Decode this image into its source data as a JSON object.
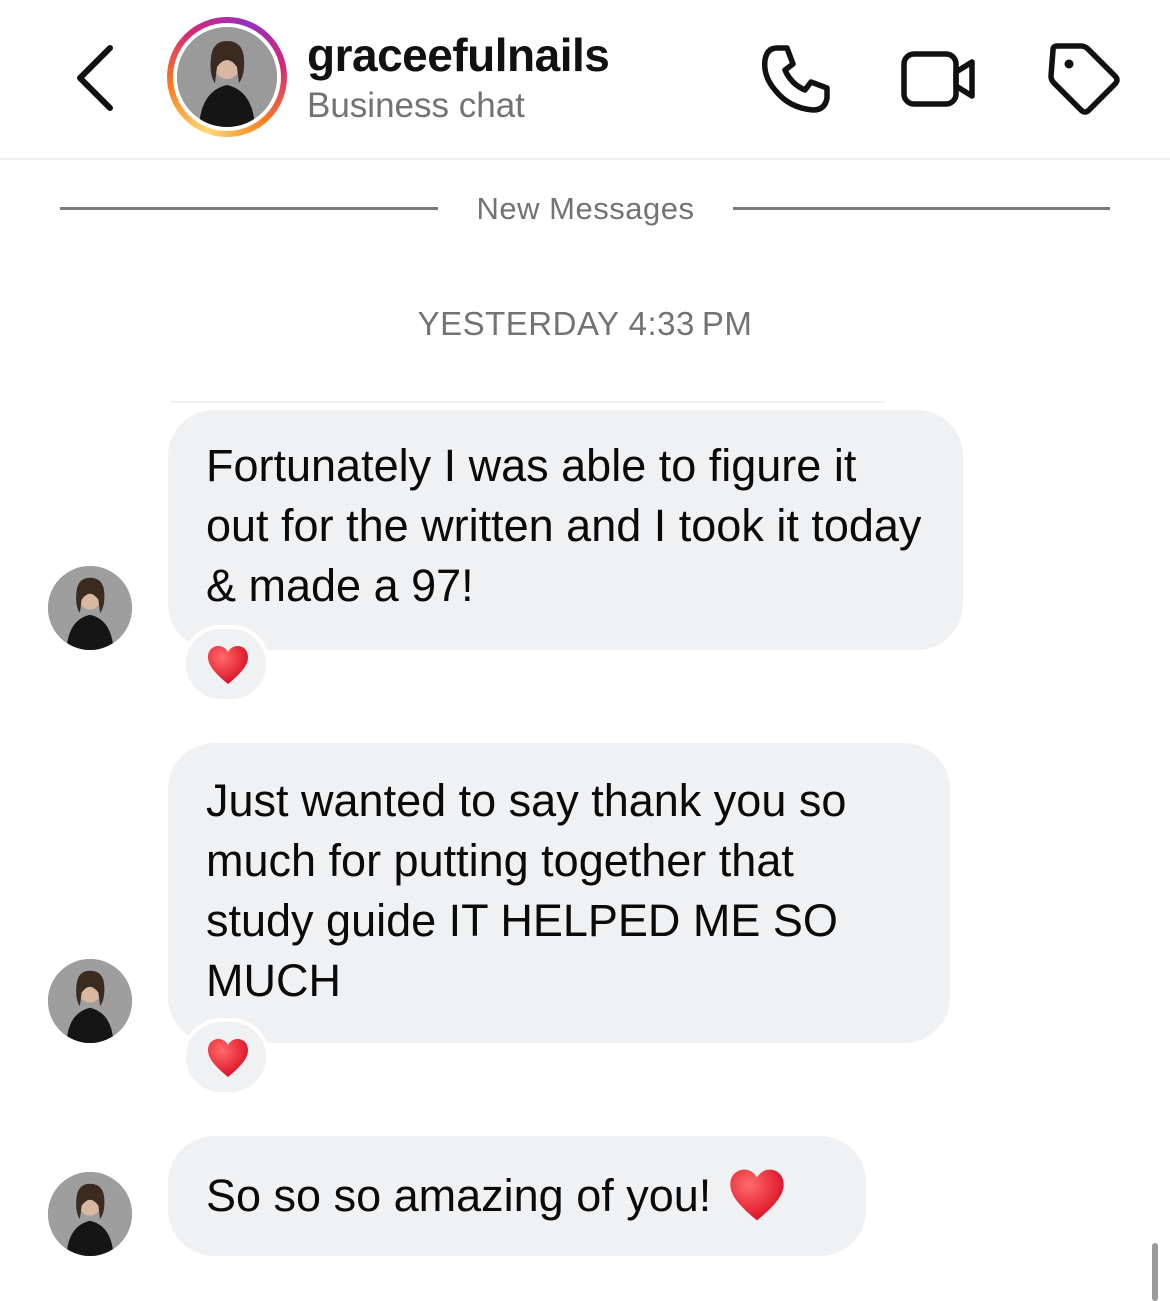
{
  "header": {
    "username": "graceefulnails",
    "subtitle": "Business chat",
    "icons": {
      "back": "chevron-left-icon",
      "call": "phone-icon",
      "video": "video-camera-icon",
      "label": "tag-icon"
    }
  },
  "divider": {
    "label": "New Messages"
  },
  "timestamp": "YESTERDAY 4:33 PM",
  "messages": [
    {
      "text": "Fortunately I was able to figure it out for the written and I took it today & made a 97!",
      "reaction": "heart"
    },
    {
      "text": "Just wanted to say thank you so much for putting together that study guide IT HELPED ME SO MUCH",
      "reaction": "heart"
    },
    {
      "text": "So so so amazing of you!",
      "inline_emoji": "heart"
    }
  ],
  "colors": {
    "bubble": "#f0f1f3",
    "secondary_text": "#737373",
    "heart": "#e8132b"
  }
}
